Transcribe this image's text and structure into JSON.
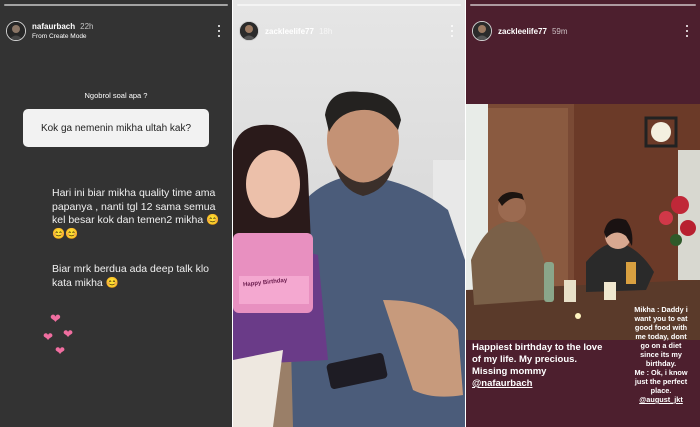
{
  "stories": [
    {
      "username": "nafaurbach",
      "time": "22h",
      "subtitle": "From Create Mode",
      "question_prompt": "Ngobrol soal apa ?",
      "question": "Kok ga nemenin mikha ultah kak?",
      "answer_p1": "Hari ini biar mikha quality time ama papanya , nanti tgl 12 sama semua kel besar kok dan temen2 mikha 😊😊😊",
      "answer_p2": "Biar mrk berdua ada deep talk klo kata mikha 😊"
    },
    {
      "username": "zackleelife77",
      "time": "18h",
      "cake_text": "Happy Birthday"
    },
    {
      "username": "zackleelife77",
      "time": "59m",
      "caption_lines": [
        "Happiest birthday to the love",
        "of my life. My precious.",
        "Missing mommy"
      ],
      "caption_mention": "@nafaurbach",
      "quote_lines": [
        "Mikha : Daddy i",
        "want you to eat",
        "good food with",
        "me today, dont",
        "go on a diet",
        "since its my",
        "birthday.",
        "Me : Ok, i know",
        "just the perfect",
        "place."
      ],
      "quote_mention": "@august_jkt"
    }
  ],
  "icons": [
    "more-vertical-icon",
    "heart-icon"
  ],
  "colors": {
    "story1_bg": "#333333",
    "story3_bg": "#4d1f2e",
    "heart": "#f06ea0",
    "pill_bg": "#f2f2f2"
  }
}
